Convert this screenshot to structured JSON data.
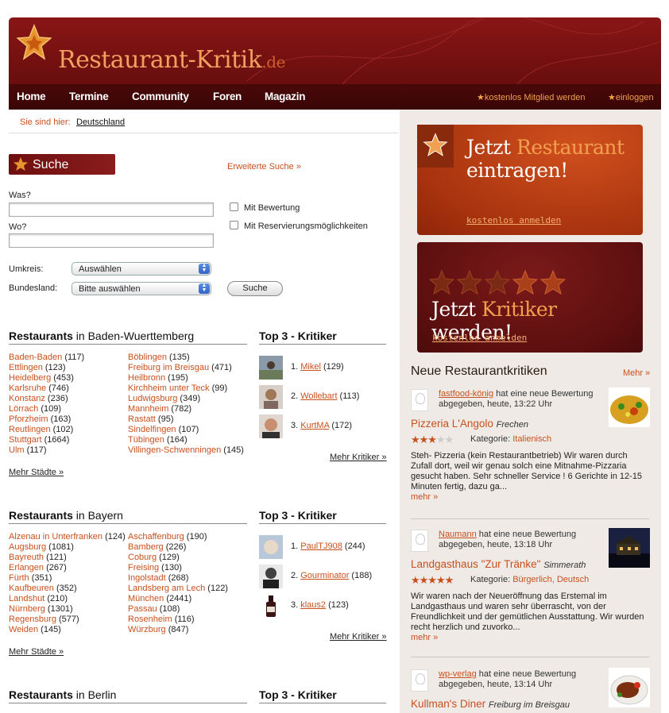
{
  "brand": {
    "name": "Restaurant-Kritik",
    "tld": ".de"
  },
  "nav": {
    "items": [
      "Home",
      "Termine",
      "Community",
      "Foren",
      "Magazin"
    ],
    "member": "kostenlos Mitglied werden",
    "login": "einloggen"
  },
  "breadcrumb": {
    "label": "Sie sind hier:",
    "value": "Deutschland"
  },
  "search": {
    "title": "Suche",
    "advanced": "Erweiterte Suche »",
    "was": "Was?",
    "wo": "Wo?",
    "cb1": "Mit Bewertung",
    "cb2": "Mit Reservierungsmöglichkeiten",
    "umkreis": "Umkreis:",
    "umkreis_value": "Auswählen",
    "bundesland": "Bundesland:",
    "bundesland_value": "Bitte auswählen",
    "button": "Suche"
  },
  "promo": {
    "r1a": "Jetzt ",
    "r1b": "Restaurant",
    "r2": "eintragen!",
    "link1": "kostenlos anmelden",
    "k1": "Jetzt ",
    "k2": "Kritiker",
    "k3": " werden!",
    "link2": "kostenlos anmelden"
  },
  "reviews": {
    "title": "Neue Restaurantkritiken",
    "more": "Mehr »",
    "items": [
      {
        "user": "fastfood-könig",
        "action": " hat eine neue Bewertung abgegeben, heute, 13:22 Uhr",
        "name": "Pizzeria L'Angolo",
        "city": "Frechen",
        "stars": 3,
        "kat_label": "Kategorie: ",
        "kat": "Italienisch",
        "text": "Steh- Pizzeria (kein Restaurantbetrieb) Wir waren durch Zufall dort, weil wir genau solch eine Mitnahme-Pizzaria gesucht haben. Sehr schneller Service ! 6 Gerichte in 12-15 Minuten fertig, dazu ga...",
        "more": "mehr »"
      },
      {
        "user": "Naumann",
        "action": " hat eine neue Bewertung abgegeben, heute, 13:18 Uhr",
        "name": "Landgasthaus \"Zur Tränke\"",
        "city": "Simmerath",
        "stars": 5,
        "kat_label": "Kategorie: ",
        "kat": "Bürgerlich, Deutsch",
        "text": "Wir waren nach der Neueröffnung das Erstemal im Landgasthaus und waren sehr überrascht, von der Freundlichkeit und der gemütlichen Ausstattung. Wir wurden recht herzlich und zuvorko...",
        "more": "mehr »"
      },
      {
        "user": "wp-verlag",
        "action": " hat eine neue Bewertung abgegeben, heute, 13:14 Uhr",
        "name": "Kullman's Diner",
        "city": "Freiburg im Breisgau"
      }
    ]
  },
  "sections": [
    {
      "h1": "Restaurants",
      "h2": " in Baden-Wuerttemberg",
      "top": "Top 3 - Kritiker",
      "col1": [
        [
          "Baden-Baden",
          "117"
        ],
        [
          "Ettlingen",
          "123"
        ],
        [
          "Heidelberg",
          "453"
        ],
        [
          "Karlsruhe",
          "746"
        ],
        [
          "Konstanz",
          "236"
        ],
        [
          "Lörrach",
          "109"
        ],
        [
          "Pforzheim",
          "163"
        ],
        [
          "Reutlingen",
          "102"
        ],
        [
          "Stuttgart",
          "1664"
        ],
        [
          "Ulm",
          "117"
        ]
      ],
      "col2": [
        [
          "Böblingen",
          "135"
        ],
        [
          "Freiburg im Breisgau",
          "471"
        ],
        [
          "Heilbronn",
          "195"
        ],
        [
          "Kirchheim unter Teck",
          "99"
        ],
        [
          "Ludwigsburg",
          "349"
        ],
        [
          "Mannheim",
          "782"
        ],
        [
          "Rastatt",
          "95"
        ],
        [
          "Sindelfingen",
          "107"
        ],
        [
          "Tübingen",
          "164"
        ],
        [
          "Villingen-Schwenningen",
          "145"
        ]
      ],
      "krit": [
        [
          "1. ",
          "Mikel",
          "129"
        ],
        [
          "2. ",
          "Wollebart",
          "113"
        ],
        [
          "3. ",
          "KurtMA",
          "172"
        ]
      ],
      "mk": "Mehr Kritiker »",
      "ms": "Mehr Städte »"
    },
    {
      "h1": "Restaurants",
      "h2": " in Bayern",
      "top": "Top 3 - Kritiker",
      "col1": [
        [
          "Alzenau in Unterfranken",
          "124"
        ],
        [
          "Augsburg",
          "1081"
        ],
        [
          "Bayreuth",
          "121"
        ],
        [
          "Erlangen",
          "267"
        ],
        [
          "Fürth",
          "351"
        ],
        [
          "Kaufbeuren",
          "352"
        ],
        [
          "Landshut",
          "210"
        ],
        [
          "Nürnberg",
          "1301"
        ],
        [
          "Regensburg",
          "577"
        ],
        [
          "Weiden",
          "145"
        ]
      ],
      "col2": [
        [
          "Aschaffenburg",
          "190"
        ],
        [
          "Bamberg",
          "226"
        ],
        [
          "Coburg",
          "129"
        ],
        [
          "Freising",
          "130"
        ],
        [
          "Ingolstadt",
          "268"
        ],
        [
          "Landsberg am Lech",
          "122"
        ],
        [
          "München",
          "2441"
        ],
        [
          "Passau",
          "108"
        ],
        [
          "Rosenheim",
          "116"
        ],
        [
          "Würzburg",
          "847"
        ]
      ],
      "krit": [
        [
          "1. ",
          "PaulTJ908",
          "244"
        ],
        [
          "2. ",
          "Gourminator",
          "188"
        ],
        [
          "3. ",
          "klaus2",
          "123"
        ]
      ],
      "mk": "Mehr Kritiker »",
      "ms": "Mehr Städte »"
    },
    {
      "h1": "Restaurants",
      "h2": " in Berlin",
      "top": "Top 3 - Kritiker"
    }
  ]
}
